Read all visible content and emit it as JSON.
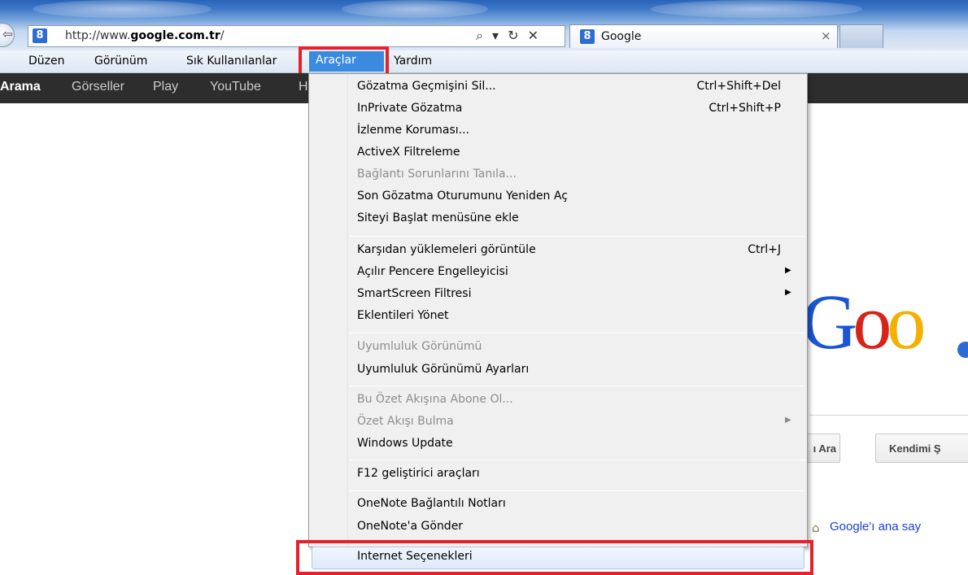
{
  "browser": {
    "url_prefix": "http://www.",
    "url_domain": "google.com.tr",
    "url_suffix": "/",
    "address_tools": "⌕ ▾ ↻ ✕",
    "favicon": "8",
    "tab_title": "Google",
    "tab_close": "×"
  },
  "menu_bar": {
    "items": [
      "Düzen",
      "Görünüm",
      "Sık Kullanılanlar",
      "Araçlar",
      "Yardım"
    ],
    "active": "Araçlar"
  },
  "google_bar": {
    "items": [
      "Arama",
      "Görseller",
      "Play",
      "YouTube",
      "H"
    ]
  },
  "page": {
    "logo_partial": [
      "G",
      "o",
      "o"
    ],
    "button_search_partial": "ı Ara",
    "button_lucky_partial": "Kendimi Ş",
    "home_link": "Google'ı ana say"
  },
  "dropdown": {
    "items": [
      {
        "label": "Gözatma Geçmişini Sil...",
        "shortcut": "Ctrl+Shift+Del"
      },
      {
        "label": "InPrivate Gözatma",
        "shortcut": "Ctrl+Shift+P"
      },
      {
        "label": "İzlenme Koruması..."
      },
      {
        "label": "ActiveX Filtreleme"
      },
      {
        "label": "Bağlantı Sorunlarını Tanıla...",
        "disabled": true
      },
      {
        "label": "Son Gözatma Oturumunu Yeniden Aç"
      },
      {
        "label": "Siteyi Başlat menüsüne ekle"
      },
      {
        "label": "Karşıdan yüklemeleri görüntüle",
        "shortcut": "Ctrl+J"
      },
      {
        "label": "Açılır Pencere Engelleyicisi",
        "submenu": true
      },
      {
        "label": "SmartScreen Filtresi",
        "submenu": true
      },
      {
        "label": "Eklentileri Yönet"
      },
      {
        "label": "Uyumluluk Görünümü",
        "disabled": true
      },
      {
        "label": "Uyumluluk Görünümü Ayarları"
      },
      {
        "label": "Bu Özet Akışına Abone Ol...",
        "disabled": true
      },
      {
        "label": "Özet Akışı Bulma",
        "disabled": true,
        "submenu": true
      },
      {
        "label": "Windows Update"
      },
      {
        "label": "F12 geliştirici araçları"
      },
      {
        "label": "OneNote Bağlantılı Notları"
      },
      {
        "label": "OneNote'a Gönder"
      },
      {
        "label": "Internet Seçenekleri",
        "hovered": true
      }
    ],
    "submenu_arrow": "▶"
  },
  "colors": {
    "highlight_box": "#e8202a",
    "menu_active": "#3a8ae0",
    "google_bar": "#2d2d2d"
  }
}
